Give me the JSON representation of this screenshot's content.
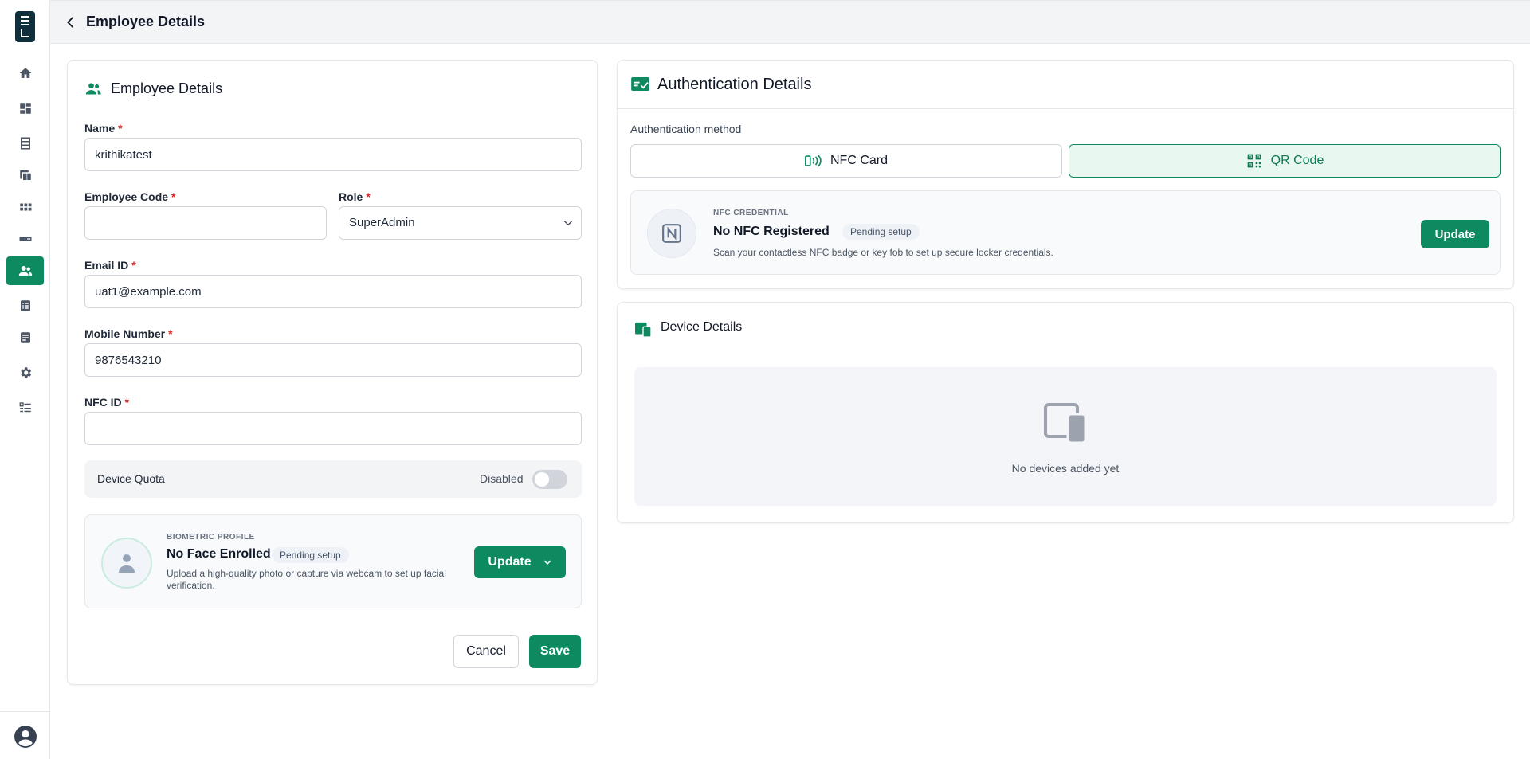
{
  "header": {
    "title": "Employee Details"
  },
  "sidebar": {
    "items": [
      {
        "icon": "home-icon"
      },
      {
        "icon": "dashboard-icon"
      },
      {
        "icon": "lockers-icon"
      },
      {
        "icon": "devices-icon"
      },
      {
        "icon": "grid-icon"
      },
      {
        "icon": "card-icon"
      },
      {
        "icon": "users-icon",
        "active": true
      },
      {
        "icon": "list-icon"
      },
      {
        "icon": "report-icon"
      },
      {
        "icon": "gear-icon"
      },
      {
        "icon": "checklist-icon"
      }
    ],
    "active_color": "#0d8a5f"
  },
  "employee": {
    "card_title": "Employee Details",
    "name_label": "Name",
    "name_value": "krithikatest",
    "code_label": "Employee Code",
    "code_value": "",
    "role_label": "Role",
    "role_value": "SuperAdmin",
    "email_label": "Email ID",
    "email_value": "uat1@example.com",
    "mobile_label": "Mobile Number",
    "mobile_value": "9876543210",
    "nfc_label": "NFC ID",
    "nfc_value": "",
    "required_mark": "*",
    "quota_label": "Device Quota",
    "quota_state": "Disabled",
    "quota_enabled": false,
    "biometric": {
      "caption": "BIOMETRIC PROFILE",
      "status": "No Face Enrolled",
      "badge": "Pending setup",
      "description": "Upload a high-quality photo or capture via webcam to set up facial verification.",
      "button": "Update"
    },
    "cancel_label": "Cancel",
    "save_label": "Save"
  },
  "auth": {
    "title": "Authentication Details",
    "method_label": "Authentication method",
    "methods": [
      {
        "label": "NFC Card",
        "selected": false
      },
      {
        "label": "QR Code",
        "selected": true
      }
    ],
    "nfc": {
      "caption": "NFC CREDENTIAL",
      "status": "No NFC Registered",
      "badge": "Pending setup",
      "description": "Scan your contactless NFC badge or key fob to set up secure locker credentials.",
      "button": "Update"
    }
  },
  "devices": {
    "title": "Device Details",
    "empty_text": "No devices added yet"
  },
  "colors": {
    "brand_green": "#0d8a5f",
    "logo_navy": "#0f2f3d",
    "required_red": "#dc2626"
  }
}
